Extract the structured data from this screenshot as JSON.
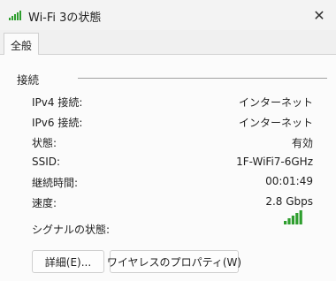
{
  "window": {
    "title": "Wi-Fi 3の状態",
    "close_glyph": "✕"
  },
  "tabs": [
    {
      "label": "全般"
    }
  ],
  "connection": {
    "section_title": "接続",
    "rows": [
      {
        "label": "IPv4 接続:",
        "value": "インターネット"
      },
      {
        "label": "IPv6 接続:",
        "value": "インターネット"
      },
      {
        "label": "状態:",
        "value": "有効"
      },
      {
        "label": "SSID:",
        "value": "1F-WiFi7-6GHz"
      },
      {
        "label": "継続時間:",
        "value": "00:01:49"
      },
      {
        "label": "速度:",
        "value": "2.8 Gbps"
      }
    ],
    "signal_label": "シグナルの状態:",
    "signal_bars_filled": 5,
    "signal_bars_total": 5,
    "signal_color": "#2e9e2e"
  },
  "buttons": {
    "details": "詳細(E)...",
    "wireless_properties": "ワイヤレスのプロパティ(W)"
  }
}
